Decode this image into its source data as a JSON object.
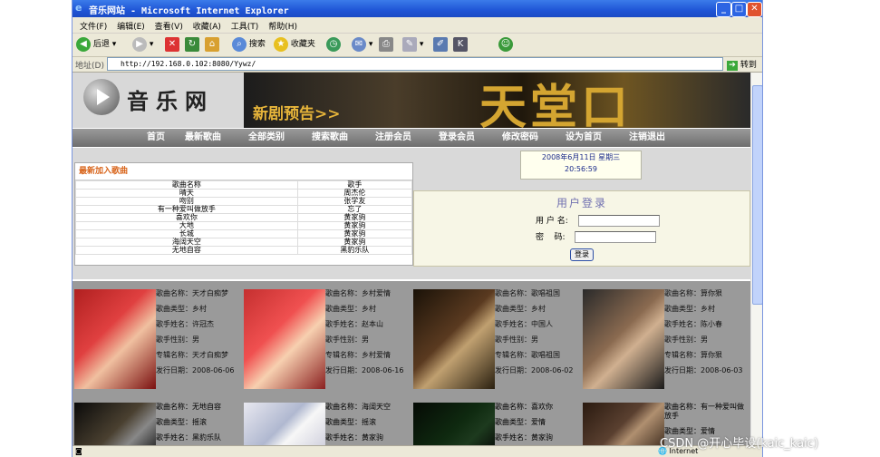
{
  "window": {
    "title": "音乐网站 - Microsoft Internet Explorer",
    "min": "_",
    "max": "□",
    "close": "✕"
  },
  "menu": [
    "文件(F)",
    "编辑(E)",
    "查看(V)",
    "收藏(A)",
    "工具(T)",
    "帮助(H)"
  ],
  "toolbar": {
    "back": "后退",
    "search": "搜索",
    "favorites": "收藏夹"
  },
  "address": {
    "label": "地址(D)",
    "url": "http://192.168.0.102:8080/Yywz/",
    "go": "转到"
  },
  "status": {
    "zone": "Internet"
  },
  "site": {
    "logo_text": "音乐网",
    "banner_promo": "新剧预告>>",
    "banner_big": "天堂口",
    "nav": [
      "首页",
      "最新歌曲",
      "全部类别",
      "搜索歌曲",
      "注册会员",
      "登录会员",
      "修改密码",
      "设为首页",
      "注销退出"
    ],
    "date": "2008年6月11日  星期三",
    "time": "20:56:59",
    "new_songs": {
      "title": "最新加入歌曲",
      "headers": [
        "歌曲名称",
        "歌手"
      ],
      "rows": [
        [
          "晴天",
          "周杰伦"
        ],
        [
          "吻别",
          "张学友"
        ],
        [
          "有一种爱叫做放手",
          "忘了"
        ],
        [
          "喜欢你",
          "黄家驹"
        ],
        [
          "大地",
          "黄家驹"
        ],
        [
          "长城",
          "黄家驹"
        ],
        [
          "海阔天空",
          "黄家驹"
        ],
        [
          "无地自容",
          "黑豹乐队"
        ]
      ]
    },
    "login": {
      "title": "用户登录",
      "user_label": "用 户 名:",
      "pwd_label": "密    码:",
      "submit": "登录"
    },
    "cards": [
      {
        "name": "歌曲名称：天才白痴梦",
        "type": "歌曲类型：乡村",
        "singer": "歌手姓名：许冠杰",
        "gender": "歌手性别：男",
        "album": "专辑名称：天才白痴梦",
        "date": "发行日期：2008-06-06"
      },
      {
        "name": "歌曲名称：乡村爱情",
        "type": "歌曲类型：乡村",
        "singer": "歌手姓名：赵本山",
        "gender": "歌手性别：男",
        "album": "专辑名称：乡村爱情",
        "date": "发行日期：2008-06-16"
      },
      {
        "name": "歌曲名称：歌唱祖国",
        "type": "歌曲类型：乡村",
        "singer": "歌手姓名：中国人",
        "gender": "歌手性别：男",
        "album": "专辑名称：歌唱祖国",
        "date": "发行日期：2008-06-02"
      },
      {
        "name": "歌曲名称：算你狠",
        "type": "歌曲类型：乡村",
        "singer": "歌手姓名：陈小春",
        "gender": "歌手性别：男",
        "album": "专辑名称：算你狠",
        "date": "发行日期：2008-06-03"
      }
    ],
    "cards2": [
      {
        "name": "歌曲名称：无地自容",
        "type": "歌曲类型：摇滚",
        "singer": "歌手姓名：黑豹乐队"
      },
      {
        "name": "歌曲名称：海阔天空",
        "type": "歌曲类型：摇滚",
        "singer": "歌手姓名：黄家驹"
      },
      {
        "name": "歌曲名称：喜欢你",
        "type": "歌曲类型：爱情",
        "singer": "歌手姓名：黄家驹"
      },
      {
        "name": "歌曲名称：有一种爱叫做放手",
        "type": "歌曲类型：爱情",
        "singer": ""
      }
    ]
  },
  "watermark": "CSDN @开心毕设(kaic_kaic)"
}
